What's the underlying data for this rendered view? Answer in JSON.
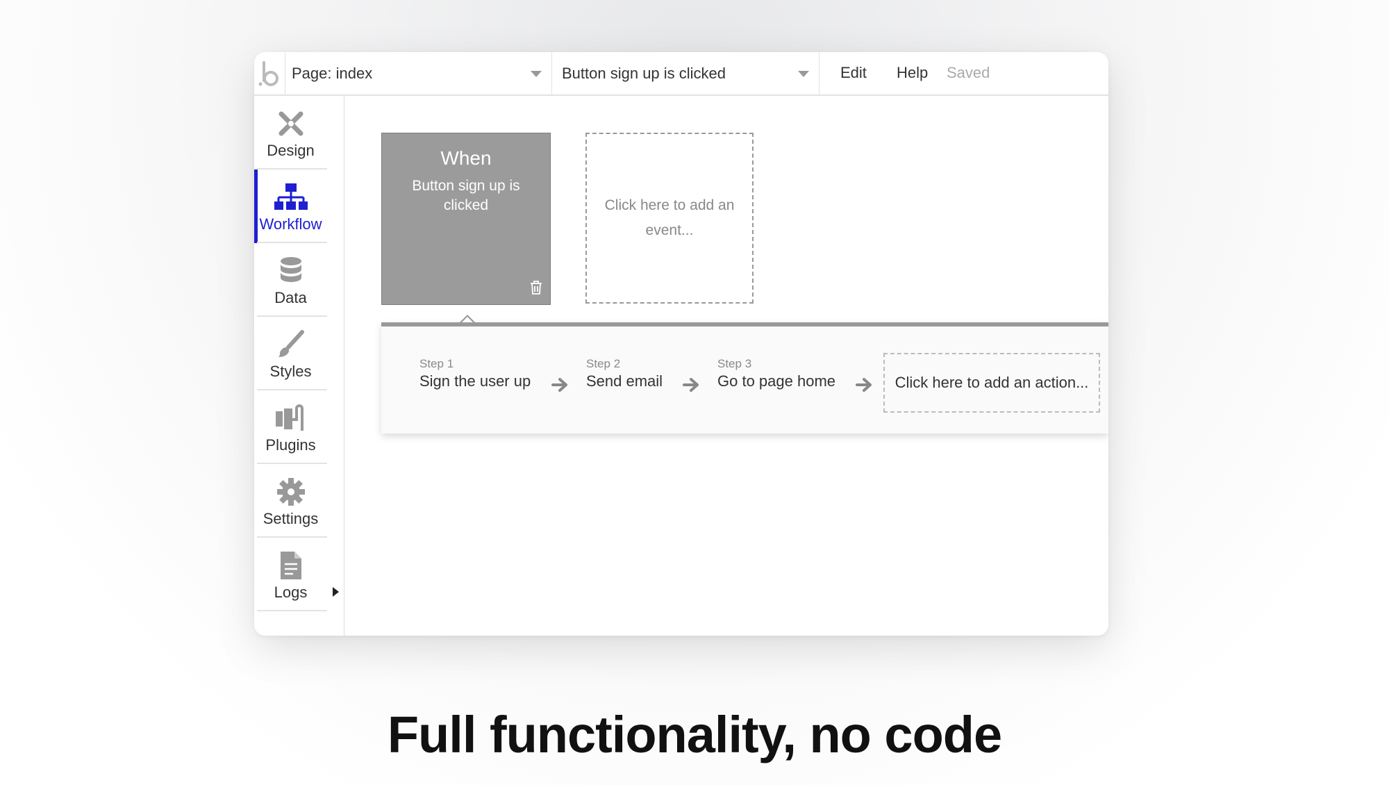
{
  "topbar": {
    "page_select": "Page: index",
    "event_select": "Button sign up is clicked",
    "edit": "Edit",
    "help": "Help",
    "status": "Saved"
  },
  "sidebar": {
    "items": [
      {
        "label": "Design",
        "icon": "design-icon"
      },
      {
        "label": "Workflow",
        "icon": "workflow-icon",
        "active": true
      },
      {
        "label": "Data",
        "icon": "database-icon"
      },
      {
        "label": "Styles",
        "icon": "brush-icon"
      },
      {
        "label": "Plugins",
        "icon": "plug-icon"
      },
      {
        "label": "Settings",
        "icon": "gear-icon"
      },
      {
        "label": "Logs",
        "icon": "document-icon"
      }
    ]
  },
  "canvas": {
    "when_card": {
      "title": "When",
      "event": "Button sign up is clicked"
    },
    "add_event": "Click here to add an event...",
    "steps": [
      {
        "num": "Step 1",
        "name": "Sign the user up"
      },
      {
        "num": "Step 2",
        "name": "Send email"
      },
      {
        "num": "Step 3",
        "name": "Go to page home"
      }
    ],
    "add_action": "Click here to add an action..."
  },
  "headline": "Full functionality, no code",
  "colors": {
    "accent": "#1d1fd0",
    "card_gray": "#9b9b9b"
  }
}
